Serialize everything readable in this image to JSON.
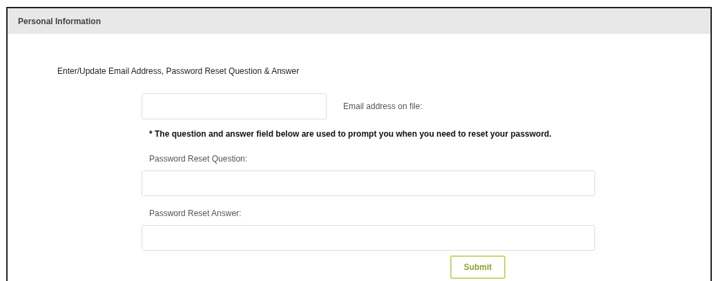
{
  "panel": {
    "title": "Personal Information"
  },
  "heading": "Enter/Update Email Address, Password Reset Question & Answer",
  "email": {
    "label": "Email address on file:"
  },
  "note": "* The question and answer field below are used to prompt you when you need to reset your password.",
  "fields": [
    {
      "label": "Password Reset Question:"
    },
    {
      "label": "Password Reset Answer:"
    }
  ],
  "submit": "Submit"
}
